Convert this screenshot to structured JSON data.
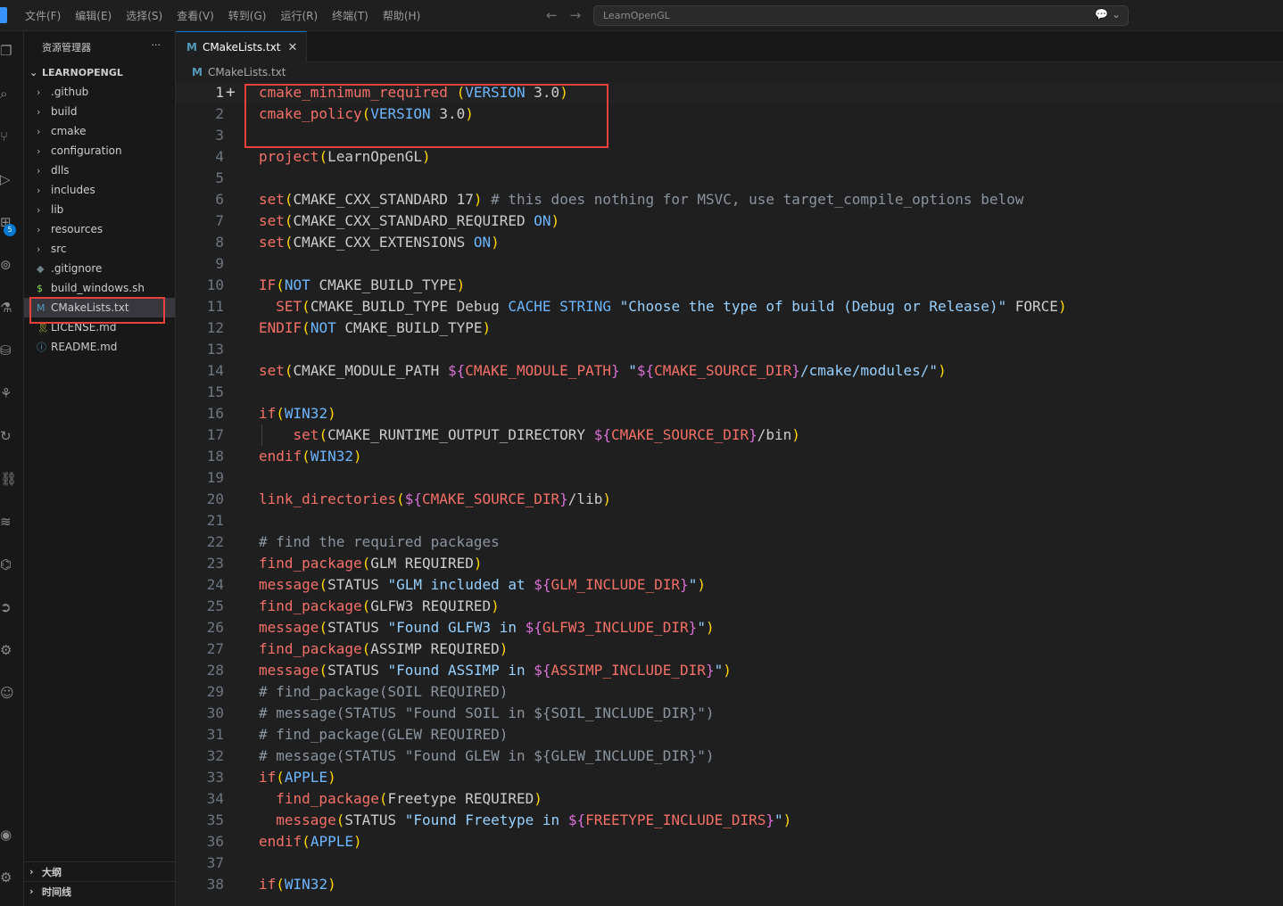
{
  "menu": [
    "文件(F)",
    "编辑(E)",
    "选择(S)",
    "查看(V)",
    "转到(G)",
    "运行(R)",
    "终端(T)",
    "帮助(H)"
  ],
  "search": {
    "text": "LearnOpenGL"
  },
  "sidebar": {
    "title": "资源管理器",
    "more": "···",
    "folder": "LEARNOPENGL",
    "items": [
      {
        "label": ".github",
        "type": "folder"
      },
      {
        "label": "build",
        "type": "folder"
      },
      {
        "label": "cmake",
        "type": "folder"
      },
      {
        "label": "configuration",
        "type": "folder"
      },
      {
        "label": "dlls",
        "type": "folder"
      },
      {
        "label": "includes",
        "type": "folder"
      },
      {
        "label": "lib",
        "type": "folder"
      },
      {
        "label": "resources",
        "type": "folder"
      },
      {
        "label": "src",
        "type": "folder"
      },
      {
        "label": ".gitignore",
        "type": "file",
        "icon": "◆",
        "color": "#6d8086"
      },
      {
        "label": "build_windows.sh",
        "type": "file",
        "icon": "$",
        "color": "#89e051"
      },
      {
        "label": "CMakeLists.txt",
        "type": "file",
        "icon": "M",
        "color": "#519aba",
        "active": true
      },
      {
        "label": "LICENSE.md",
        "type": "file",
        "icon": "🎗",
        "color": "#cbcb41"
      },
      {
        "label": "README.md",
        "type": "file",
        "icon": "ⓘ",
        "color": "#519aba"
      }
    ],
    "outline": "大纲",
    "timeline": "时间线"
  },
  "activity_badge": "5",
  "tab": {
    "label": "CMakeLists.txt",
    "icon": "M",
    "close": "✕"
  },
  "breadcrumb": "CMakeLists.txt",
  "code_lines": [
    "cmake_minimum_required (VERSION 3.0)",
    "cmake_policy(VERSION 3.0)",
    "",
    "project(LearnOpenGL)",
    "",
    "set(CMAKE_CXX_STANDARD 17) # this does nothing for MSVC, use target_compile_options below",
    "set(CMAKE_CXX_STANDARD_REQUIRED ON)",
    "set(CMAKE_CXX_EXTENSIONS ON)",
    "",
    "IF(NOT CMAKE_BUILD_TYPE)",
    "  SET(CMAKE_BUILD_TYPE Debug CACHE STRING \"Choose the type of build (Debug or Release)\" FORCE)",
    "ENDIF(NOT CMAKE_BUILD_TYPE)",
    "",
    "set(CMAKE_MODULE_PATH ${CMAKE_MODULE_PATH} \"${CMAKE_SOURCE_DIR}/cmake/modules/\")",
    "",
    "if(WIN32)",
    "    set(CMAKE_RUNTIME_OUTPUT_DIRECTORY ${CMAKE_SOURCE_DIR}/bin)",
    "endif(WIN32)",
    "",
    "link_directories(${CMAKE_SOURCE_DIR}/lib)",
    "",
    "# find the required packages",
    "find_package(GLM REQUIRED)",
    "message(STATUS \"GLM included at ${GLM_INCLUDE_DIR}\")",
    "find_package(GLFW3 REQUIRED)",
    "message(STATUS \"Found GLFW3 in ${GLFW3_INCLUDE_DIR}\")",
    "find_package(ASSIMP REQUIRED)",
    "message(STATUS \"Found ASSIMP in ${ASSIMP_INCLUDE_DIR}\")",
    "# find_package(SOIL REQUIRED)",
    "# message(STATUS \"Found SOIL in ${SOIL_INCLUDE_DIR}\")",
    "# find_package(GLEW REQUIRED)",
    "# message(STATUS \"Found GLEW in ${GLEW_INCLUDE_DIR}\")",
    "if(APPLE)",
    "  find_package(Freetype REQUIRED)",
    "  message(STATUS \"Found Freetype in ${FREETYPE_INCLUDE_DIRS}\")",
    "endif(APPLE)",
    "",
    "if(WIN32)"
  ]
}
